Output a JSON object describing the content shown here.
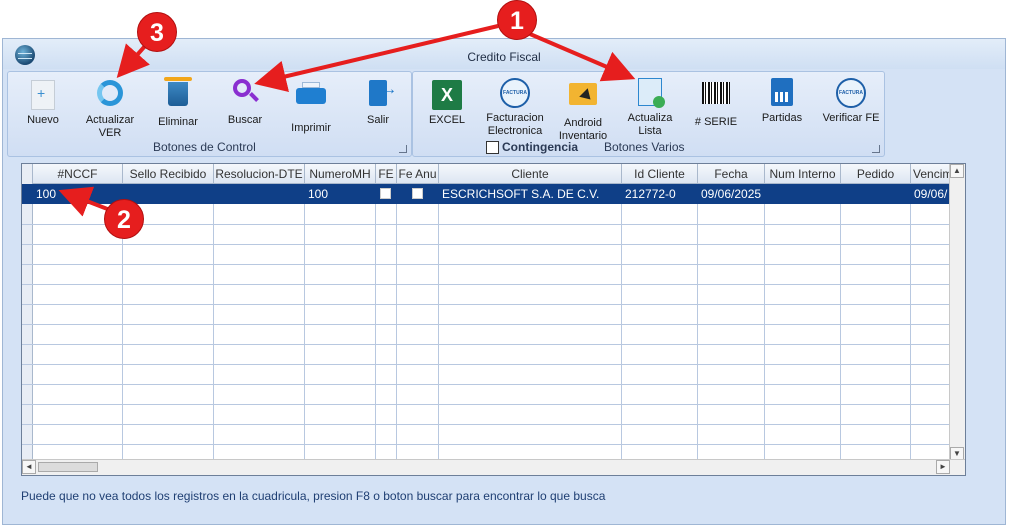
{
  "window": {
    "title": "Credito Fiscal"
  },
  "control_group": {
    "caption": "Botones de Control",
    "buttons": [
      {
        "label": "Nuevo",
        "icon": "new-document-icon"
      },
      {
        "label": "Actualizar",
        "label2": "VER",
        "icon": "refresh-icon"
      },
      {
        "label": "Eliminar",
        "icon": "trash-icon"
      },
      {
        "label": "Buscar",
        "icon": "search-icon"
      },
      {
        "label": "Imprimir",
        "icon": "printer-icon"
      },
      {
        "label": "Salir",
        "icon": "exit-icon"
      }
    ]
  },
  "varios_group": {
    "caption": "Botones Varios",
    "contingencia_label": "Contingencia",
    "contingencia_checked": false,
    "buttons": [
      {
        "label": "EXCEL",
        "icon": "excel-icon"
      },
      {
        "label": "Facturacion",
        "label2": "Electronica",
        "icon": "e-invoice-seal-icon"
      },
      {
        "label": "Android",
        "label2": "Inventario",
        "icon": "folder-icon"
      },
      {
        "label": "Actualiza",
        "label2": "Lista",
        "icon": "update-list-icon"
      },
      {
        "label": "# SERIE",
        "icon": "barcode-icon"
      },
      {
        "label": "Partidas",
        "icon": "ledger-icon"
      },
      {
        "label": "Verificar FE",
        "icon": "e-invoice-seal-icon"
      }
    ]
  },
  "grid": {
    "columns": [
      "#NCCF",
      "Sello Recibido",
      "Resolucion-DTE",
      "NumeroMH",
      "FE",
      "Fe Anu",
      "Cliente",
      "Id Cliente",
      "Fecha",
      "Num Interno",
      "Pedido",
      "Vencim"
    ],
    "rows": [
      {
        "nccf": "100",
        "sello": "",
        "resolucion": "",
        "numeromh": "100",
        "fe": false,
        "fe_anu": false,
        "cliente": "ESCRICHSOFT S.A. DE C.V.",
        "id_cliente": "212772-0",
        "fecha": "09/06/2025",
        "num_interno": "",
        "pedido": "",
        "vencim": "09/06/"
      }
    ]
  },
  "status_text": "Puede que no vea todos los registros en la cuadricula, presion F8 o boton buscar para encontrar lo que busca",
  "annotations": {
    "badge1": "1",
    "badge2": "2",
    "badge3": "3",
    "color": "#e61e1e"
  }
}
